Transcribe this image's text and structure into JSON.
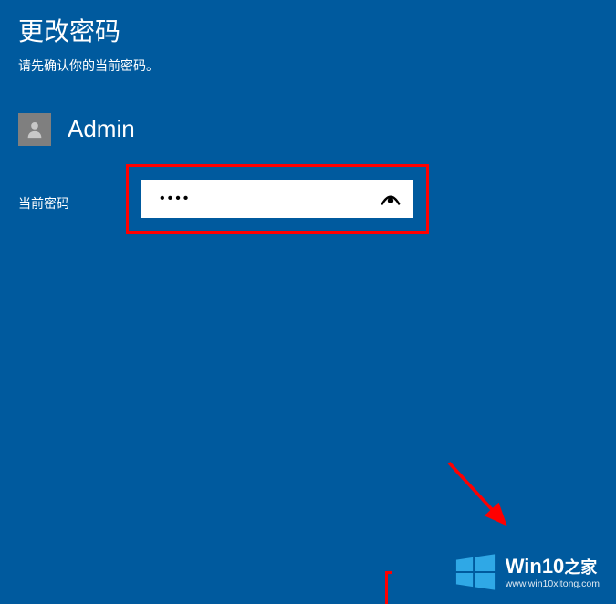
{
  "page": {
    "title": "更改密码",
    "subtitle": "请先确认你的当前密码。"
  },
  "user": {
    "name": "Admin"
  },
  "form": {
    "current_password_label": "当前密码",
    "current_password_value": "••••",
    "reveal_icon": "eye-icon"
  },
  "watermark": {
    "title_en": "Win10",
    "title_zh": "之家",
    "url": "www.win10xitong.com"
  },
  "colors": {
    "background": "#005a9e",
    "highlight_border": "#ff0000",
    "input_bg": "#ffffff",
    "avatar_bg": "#7f7f7f"
  }
}
